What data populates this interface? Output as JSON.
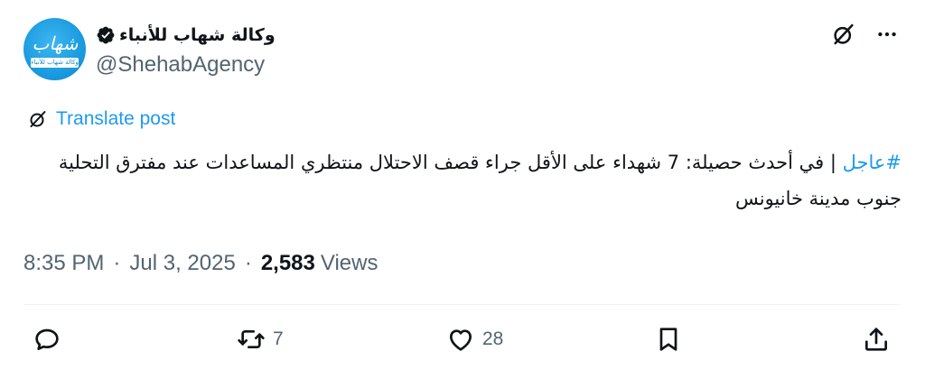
{
  "author": {
    "display_name": "وكالة شهاب للأنباء",
    "handle": "@ShehabAgency",
    "avatar_text": "وكالة شهاب للأنباء",
    "avatar_logo_text": "شهاب",
    "verified_icon": "verified-badge-icon"
  },
  "top_actions": {
    "grok_icon": "grok-icon",
    "more_icon": "more-icon"
  },
  "translate": {
    "label": "Translate post",
    "icon": "grok-icon"
  },
  "post": {
    "hashtag": "#عاجل",
    "body": " | في أحدث حصيلة: 7 شهداء على الأقل جراء قصف الاحتلال منتظري المساعدات عند مفترق التحلية جنوب مدينة خانيونس"
  },
  "meta": {
    "time": "8:35 PM",
    "dot1": "·",
    "date": "Jul 3, 2025",
    "dot2": "·",
    "views_count": "2,583",
    "views_label": "Views"
  },
  "actions": {
    "reply": {
      "icon": "reply-icon",
      "count": ""
    },
    "repost": {
      "icon": "repost-icon",
      "count": "7"
    },
    "like": {
      "icon": "heart-icon",
      "count": "28"
    },
    "bookmark": {
      "icon": "bookmark-icon",
      "count": ""
    },
    "share": {
      "icon": "share-icon",
      "count": ""
    }
  },
  "colors": {
    "accent": "#1d9bf0",
    "text": "#0f1419",
    "secondary": "#536471",
    "divider": "#eff3f4"
  }
}
